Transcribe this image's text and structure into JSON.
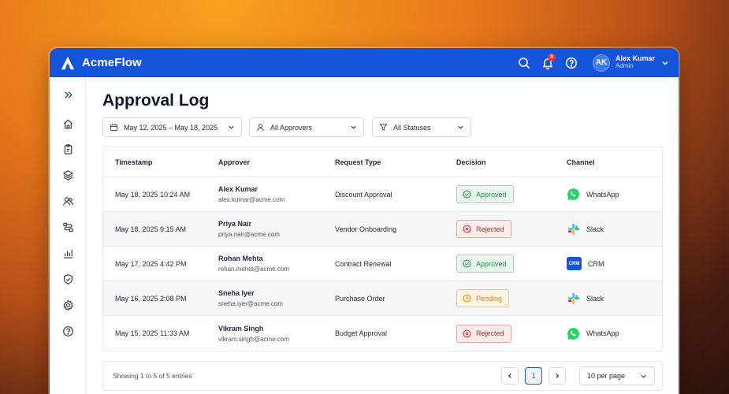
{
  "app": {
    "name": "AcmeFlow"
  },
  "header": {
    "notifications_count": "3",
    "user": {
      "initials": "AK",
      "name": "Alex Kumar",
      "role": "Admin"
    }
  },
  "sidebar": {
    "items": [
      {
        "icon": "expand-icon"
      },
      {
        "icon": "home-icon"
      },
      {
        "icon": "clipboard-icon"
      },
      {
        "icon": "layers-icon"
      },
      {
        "icon": "users-icon"
      },
      {
        "icon": "workflow-icon"
      },
      {
        "icon": "bar-chart-icon"
      },
      {
        "icon": "shield-check-icon"
      },
      {
        "icon": "settings-icon"
      },
      {
        "icon": "help-icon"
      }
    ]
  },
  "page": {
    "title": "Approval Log"
  },
  "filters": {
    "date_range": "May 12, 2025 – May 18, 2025",
    "approver": "All Approvers",
    "status": "All Statuses"
  },
  "table": {
    "columns": [
      "Timestamp",
      "Approver",
      "Request Type",
      "Decision",
      "Channel"
    ],
    "rows": [
      {
        "timestamp": "May 18, 2025 10:24 AM",
        "name": "Alex Kumar",
        "email": "alex.kumar@acme.com",
        "request_type": "Discount Approval",
        "decision": "Approved",
        "channel": "WhatsApp"
      },
      {
        "timestamp": "May 18, 2025 9:15 AM",
        "name": "Priya Nair",
        "email": "priya.nair@acme.com",
        "request_type": "Vendor Onboarding",
        "decision": "Rejected",
        "channel": "Slack"
      },
      {
        "timestamp": "May 17, 2025 4:42 PM",
        "name": "Rohan Mehta",
        "email": "rohan.mehta@acme.com",
        "request_type": "Contract Renewal",
        "decision": "Approved",
        "channel": "CRM"
      },
      {
        "timestamp": "May 16, 2025 2:08 PM",
        "name": "Sneha Iyer",
        "email": "sneha.iyer@acme.com",
        "request_type": "Purchase Order",
        "decision": "Pending",
        "channel": "Slack"
      },
      {
        "timestamp": "May 15, 2025 11:33 AM",
        "name": "Vikram Singh",
        "email": "vikram.singh@acme.com",
        "request_type": "Budget Approval",
        "decision": "Rejected",
        "channel": "WhatsApp"
      }
    ]
  },
  "crm_badge_text": "CRM",
  "footer": {
    "summary": "Showing 1 to 5 of 5 entries",
    "current_page": "1",
    "per_page": "10 per page"
  },
  "colors": {
    "brand": "#1553d8",
    "approved": "#1e8a43",
    "rejected": "#c62828",
    "pending": "#d9820f",
    "whatsapp": "#25d366"
  }
}
